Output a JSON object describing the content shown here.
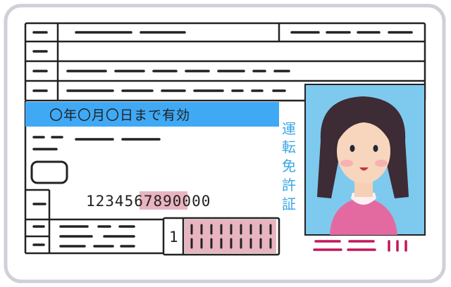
{
  "card": {
    "expiry_text": "〇年〇月〇日まで有効",
    "title_vertical": [
      "運",
      "転",
      "免",
      "許",
      "証"
    ],
    "license_number": "1234567890000",
    "number_highlight": "5678",
    "category_marker": "1",
    "colors": {
      "border": "#cfd0d8",
      "expiry_band": "#3fa9f5",
      "photo_bg": "#7ec9ee",
      "pink": "#e8b4c0",
      "title_text": "#3ba6e6",
      "shirt": "#e36aa1"
    },
    "illustration": "woman-portrait"
  }
}
